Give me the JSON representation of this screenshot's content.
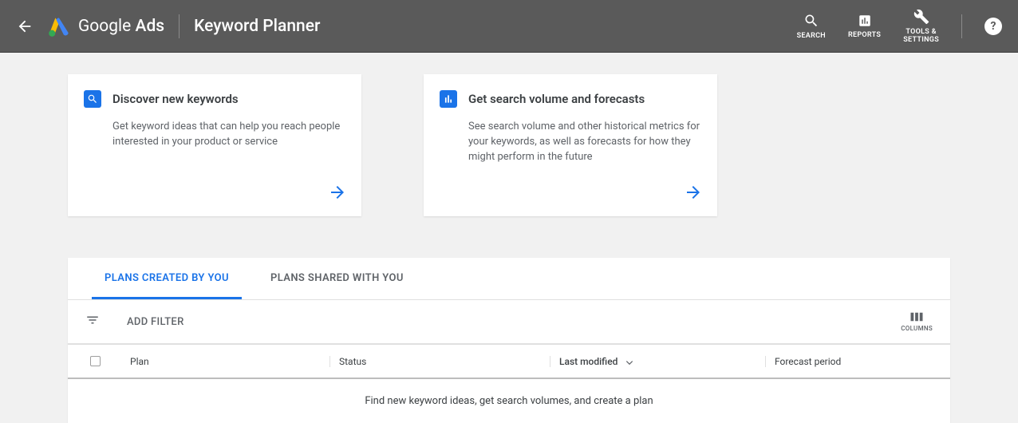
{
  "header": {
    "brand_prefix": "Google",
    "brand_suffix": "Ads",
    "title": "Keyword Planner",
    "nav": {
      "search": "SEARCH",
      "reports": "REPORTS",
      "tools": "TOOLS &\nSETTINGS"
    }
  },
  "cards": {
    "discover": {
      "title": "Discover new keywords",
      "desc": "Get keyword ideas that can help you reach people interested in your product or service"
    },
    "forecasts": {
      "title": "Get search volume and forecasts",
      "desc": "See search volume and other historical metrics for your keywords, as well as forecasts for how they might perform in the future"
    }
  },
  "plans": {
    "tabs": {
      "by_you": "PLANS CREATED BY YOU",
      "shared": "PLANS SHARED WITH YOU"
    },
    "add_filter": "ADD FILTER",
    "columns_label": "COLUMNS",
    "table": {
      "col_plan": "Plan",
      "col_status": "Status",
      "col_modified": "Last modified",
      "col_forecast": "Forecast period",
      "empty": "Find new keyword ideas, get search volumes, and create a plan"
    }
  }
}
